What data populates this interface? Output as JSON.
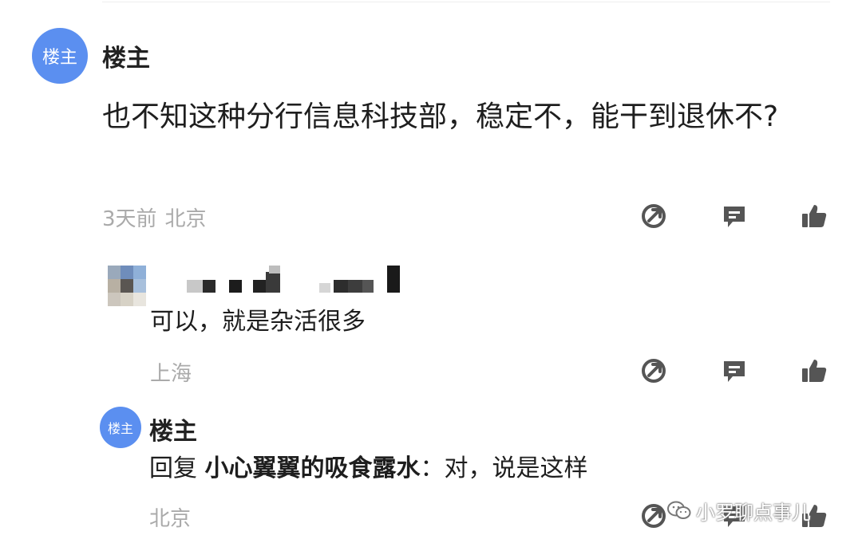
{
  "main_comment": {
    "avatar_label": "楼主",
    "author": "楼主",
    "text": "也不知这种分行信息科技部，稳定不，能干到退休不?",
    "time": "3天前",
    "location": "北京"
  },
  "reply_1": {
    "text": "可以，就是杂活很多",
    "location": "上海"
  },
  "reply_2": {
    "avatar_label": "楼主",
    "author": "楼主",
    "reply_prefix": "回复",
    "reply_target": "小心翼翼的吸食露水",
    "reply_sep": "：",
    "text": "对，说是这样",
    "location": "北京"
  },
  "icons": [
    "share-icon",
    "comment-icon",
    "thumbs-up-icon"
  ],
  "colors": {
    "avatar_bg": "#5b8ff0",
    "meta_text": "#aaaaaa",
    "icon_gray": "#555555"
  },
  "watermark": {
    "text": "小罗聊点事儿"
  }
}
